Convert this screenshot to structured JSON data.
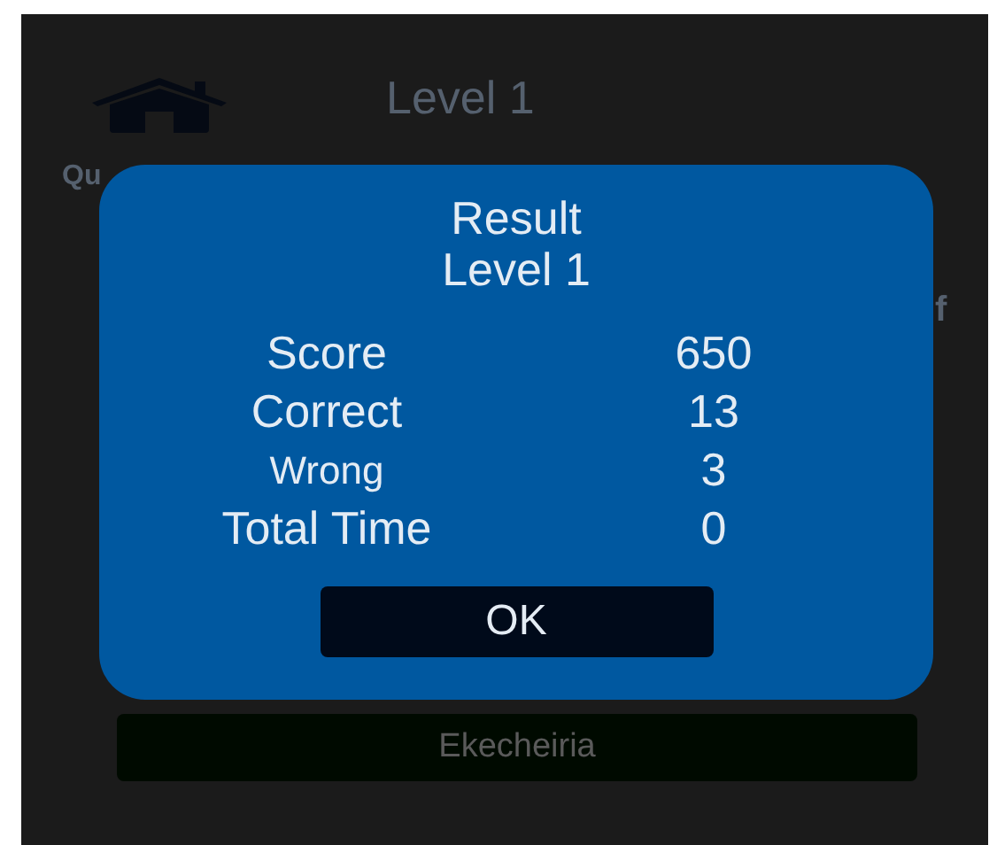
{
  "header": {
    "title": "Level 1"
  },
  "question": {
    "label": "Qu",
    "text": "f"
  },
  "answers": [
    {
      "label": "Ekecheiria"
    }
  ],
  "dialog": {
    "title": "Result",
    "subtitle": "Level 1",
    "stats": [
      {
        "label": "Score",
        "value": "650",
        "kind": "large"
      },
      {
        "label": "Correct",
        "value": "13",
        "kind": "large"
      },
      {
        "label": "Wrong",
        "value": "3",
        "kind": "small"
      },
      {
        "label": "Total Time",
        "value": "0",
        "kind": "large"
      }
    ],
    "button": "OK"
  }
}
